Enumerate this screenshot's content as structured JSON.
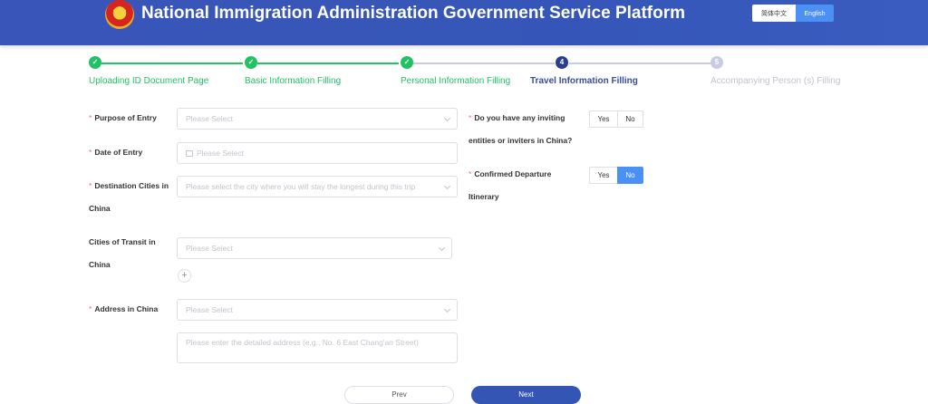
{
  "header": {
    "title": "National Immigration Administration Government Service Platform",
    "lang_zh": "简体中文",
    "lang_en": "English",
    "colors": {
      "bar": "#3556b8",
      "active_lang": "#4b90f5"
    }
  },
  "steps": [
    {
      "label": "Uploading ID Document Page",
      "state": "done",
      "icon": "check-icon"
    },
    {
      "label": "Basic Information Filling",
      "state": "done",
      "icon": "check-icon"
    },
    {
      "label": "Personal Information Filling",
      "state": "done",
      "icon": "check-icon"
    },
    {
      "label": "Travel Information Filling",
      "state": "current",
      "number": "4"
    },
    {
      "label": "Accompanying Person (s) Filling",
      "state": "todo",
      "number": "5"
    }
  ],
  "form": {
    "purpose": {
      "label": "Purpose of Entry",
      "placeholder": "Please Select"
    },
    "date": {
      "label": "Date of Entry",
      "placeholder": "Please Select"
    },
    "destination": {
      "label_line1": "Destination Cities in",
      "label_line2": "China",
      "placeholder": "Please select the city where you will stay the longest during this trip"
    },
    "transit": {
      "label_line1": "Cities of Transit in",
      "label_line2": "China",
      "placeholder": "Please Select"
    },
    "address": {
      "label": "Address in China",
      "placeholder": "Please Select",
      "detail_placeholder": "Please enter the detailed address (e.g., No. 6 East Chang'an Street)"
    },
    "inviting": {
      "label_line1": "Do you have any inviting",
      "label_line2": "entities or inviters in China?",
      "yes": "Yes",
      "no": "No",
      "selected": "none"
    },
    "departure": {
      "label_line1": "Confirmed Departure",
      "label_line2": "Itinerary",
      "yes": "Yes",
      "no": "No",
      "selected": "No"
    },
    "required_mark": "*",
    "add_symbol": "+"
  },
  "buttons": {
    "prev": "Prev",
    "next": "Next"
  },
  "colors": {
    "done": "#22c164",
    "current": "#2c3e8e",
    "todo": "#c9cbe6",
    "primary": "#3555b5"
  }
}
